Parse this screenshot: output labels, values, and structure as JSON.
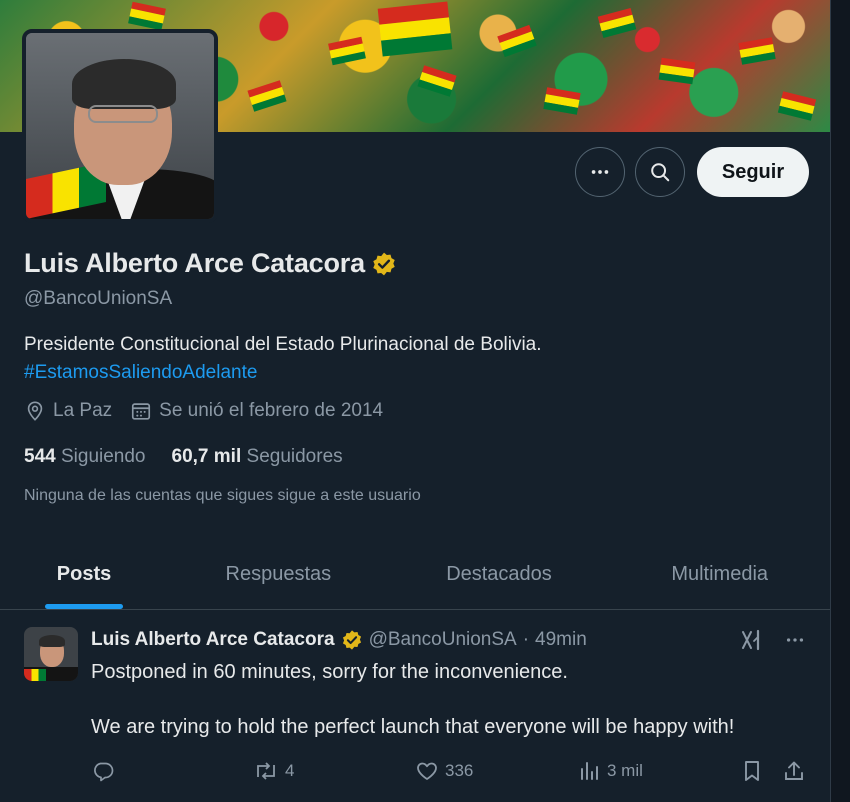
{
  "profile": {
    "name": "Luis Alberto Arce Catacora",
    "handle": "@BancoUnionSA",
    "bio": "Presidente Constitucional del Estado Plurinacional de Bolivia.",
    "hashtag": "#EstamosSaliendoAdelante",
    "location": "La Paz",
    "joined": "Se unió el febrero de 2014",
    "following_count": "544",
    "following_label": "Siguiendo",
    "followers_count": "60,7 mil",
    "followers_label": "Seguidores",
    "mutual_note": "Ninguna de las cuentas que sigues sigue a este usuario"
  },
  "actions": {
    "follow_label": "Seguir",
    "more_icon": "more-icon",
    "search_icon": "search-icon"
  },
  "tabs": [
    {
      "label": "Posts",
      "active": true
    },
    {
      "label": "Respuestas",
      "active": false
    },
    {
      "label": "Destacados",
      "active": false
    },
    {
      "label": "Multimedia",
      "active": false
    }
  ],
  "tweet": {
    "name": "Luis Alberto Arce Catacora",
    "handle": "@BancoUnionSA",
    "separator": "·",
    "time": "49min",
    "text1": "Postponed in 60 minutes, sorry for the inconvenience.",
    "text2": "We are trying to hold the perfect launch that everyone will be happy with!",
    "retweets": "4",
    "likes": "336",
    "views": "3 mil"
  },
  "colors": {
    "background": "#15202b",
    "accent": "#1d9bf0",
    "verified_gold": "#e2b719",
    "secondary_text": "#8b98a5"
  }
}
